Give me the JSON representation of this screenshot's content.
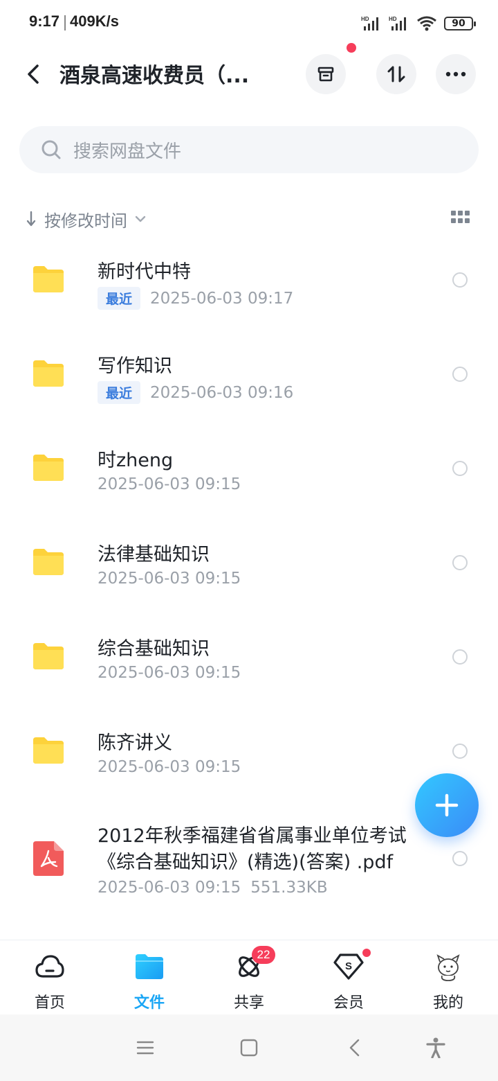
{
  "status_bar": {
    "time": "9:17",
    "speed": "409K/s",
    "battery": "90"
  },
  "header": {
    "title": "酒泉高速收费员（..."
  },
  "search": {
    "placeholder": "搜索网盘文件"
  },
  "sort": {
    "label": "按修改时间"
  },
  "files": [
    {
      "name": "新时代中特",
      "badge": "最近",
      "datetime": "2025-06-03  09:17",
      "type": "folder"
    },
    {
      "name": "写作知识",
      "badge": "最近",
      "datetime": "2025-06-03  09:16",
      "type": "folder"
    },
    {
      "name": "时zheng",
      "badge": "",
      "datetime": "2025-06-03  09:15",
      "type": "folder"
    },
    {
      "name": "法律基础知识",
      "badge": "",
      "datetime": "2025-06-03  09:15",
      "type": "folder"
    },
    {
      "name": "综合基础知识",
      "badge": "",
      "datetime": "2025-06-03  09:15",
      "type": "folder"
    },
    {
      "name": "陈齐讲义",
      "badge": "",
      "datetime": "2025-06-03  09:15",
      "type": "folder"
    },
    {
      "name_line1": "2012年秋季福建省省属事业单位考试",
      "name_line2": "《综合基础知识》(精选)(答案) .pdf",
      "datetime": "2025-06-03  09:15",
      "size": "551.33KB",
      "type": "pdf"
    }
  ],
  "tabbar": {
    "items": [
      {
        "label": "首页",
        "icon": "cloud-icon"
      },
      {
        "label": "文件",
        "icon": "folder-icon",
        "active": true
      },
      {
        "label": "共享",
        "icon": "atom-icon",
        "badge": "22"
      },
      {
        "label": "会员",
        "icon": "vip-diamond-icon"
      },
      {
        "label": "我的",
        "icon": "avatar-icon"
      }
    ]
  },
  "colors": {
    "accent": "#1aa6f5",
    "badge_red": "#f63d5a",
    "folder": "#fdd23b",
    "pdf": "#f15b5b"
  }
}
